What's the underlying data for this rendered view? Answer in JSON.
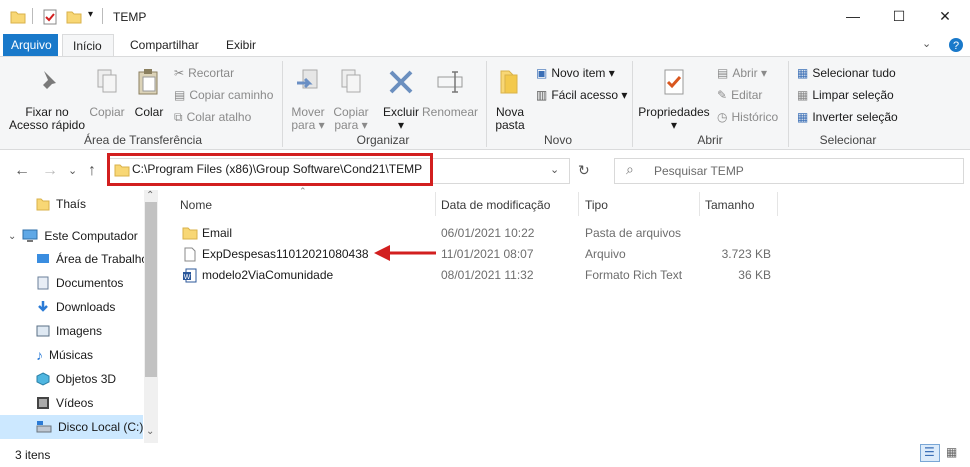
{
  "window": {
    "title": "TEMP"
  },
  "tabs": [
    "Arquivo",
    "Início",
    "Compartilhar",
    "Exibir"
  ],
  "ribbon": {
    "clipboard": {
      "label": "Área de Transferência",
      "pin": "Fixar no\nAcesso rápido",
      "copy": "Copiar",
      "paste": "Colar",
      "cut": "Recortar",
      "copy_path": "Copiar caminho",
      "paste_shortcut": "Colar atalho"
    },
    "organize": {
      "label": "Organizar",
      "move_to": "Mover\npara ▾",
      "copy_to": "Copiar\npara ▾",
      "delete": "Excluir\n▾",
      "rename": "Renomear"
    },
    "new": {
      "label": "Novo",
      "new_folder": "Nova\npasta",
      "new_item": "Novo item ▾",
      "easy_access": "Fácil acesso ▾"
    },
    "open": {
      "label": "Abrir",
      "properties": "Propriedades\n▾",
      "open": "Abrir ▾",
      "edit": "Editar",
      "history": "Histórico"
    },
    "select": {
      "label": "Selecionar",
      "select_all": "Selecionar tudo",
      "select_none": "Limpar seleção",
      "invert": "Inverter seleção"
    }
  },
  "address": {
    "path": "C:\\Program Files (x86)\\Group Software\\Cond21\\TEMP"
  },
  "search": {
    "placeholder": "Pesquisar TEMP"
  },
  "nav": [
    {
      "label": "Thaís",
      "icon": "folder-icon"
    },
    {
      "label": "Este Computador",
      "icon": "computer-icon"
    },
    {
      "label": "Área de Trabalho",
      "icon": "desktop-icon"
    },
    {
      "label": "Documentos",
      "icon": "documents-icon"
    },
    {
      "label": "Downloads",
      "icon": "downloads-icon"
    },
    {
      "label": "Imagens",
      "icon": "pictures-icon"
    },
    {
      "label": "Músicas",
      "icon": "music-icon"
    },
    {
      "label": "Objetos 3D",
      "icon": "objects3d-icon"
    },
    {
      "label": "Vídeos",
      "icon": "videos-icon"
    },
    {
      "label": "Disco Local (C:)",
      "icon": "drive-icon"
    }
  ],
  "columns": [
    "Nome",
    "Data de modificação",
    "Tipo",
    "Tamanho"
  ],
  "files": [
    {
      "name": "Email",
      "date": "06/01/2021 10:22",
      "type": "Pasta de arquivos",
      "size": "",
      "icon": "folder-icon"
    },
    {
      "name": "ExpDespesas11012021080438",
      "date": "11/01/2021 08:07",
      "type": "Arquivo",
      "size": "3.723 KB",
      "icon": "file-icon"
    },
    {
      "name": "modelo2ViaComunidade",
      "date": "08/01/2021 11:32",
      "type": "Formato Rich Text",
      "size": "36 KB",
      "icon": "word-doc-icon"
    }
  ],
  "status": {
    "count": "3 itens"
  },
  "colors": {
    "accent": "#1979ca",
    "highlight": "#d21f1f",
    "folder": "#f8d775"
  }
}
